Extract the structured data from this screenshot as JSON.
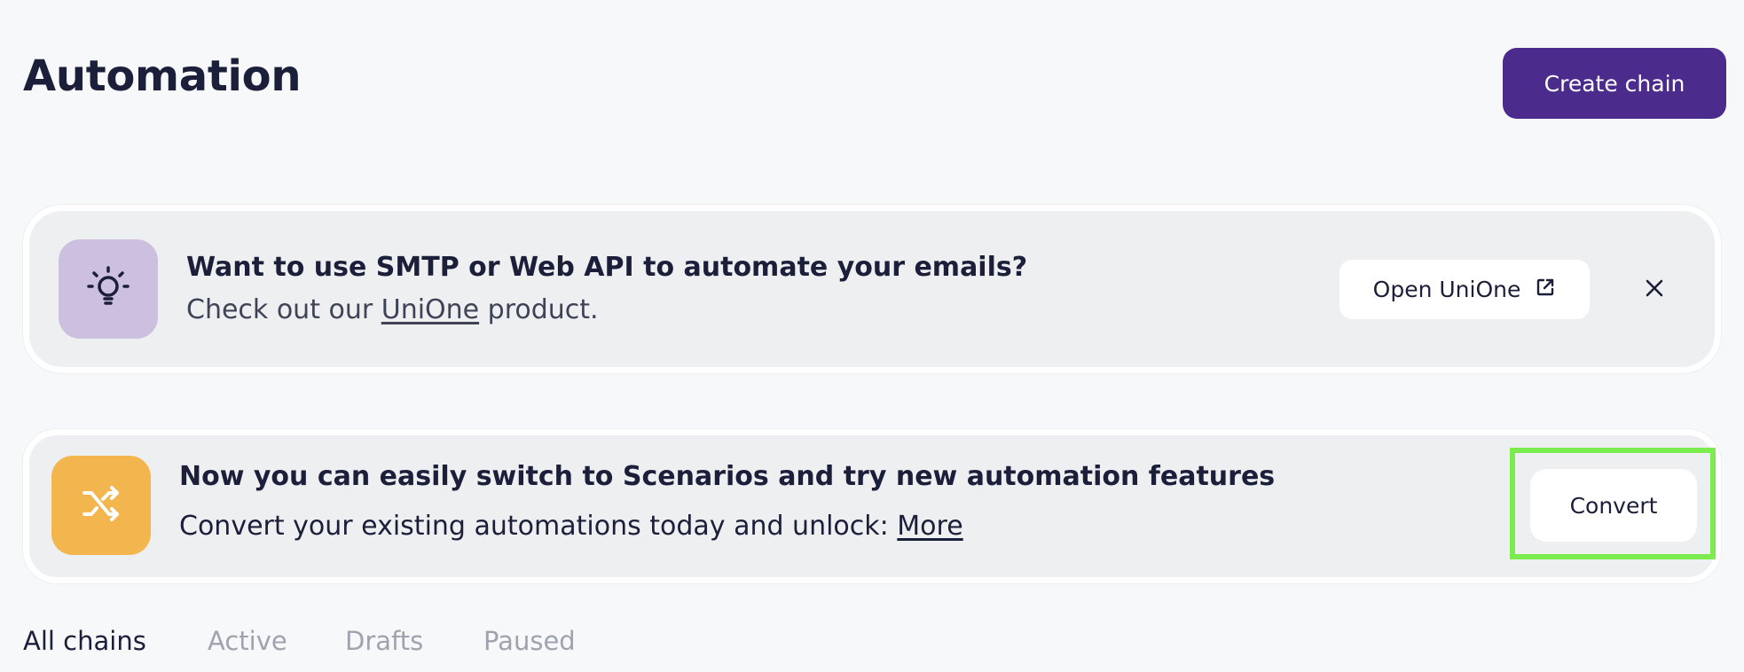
{
  "header": {
    "title": "Automation",
    "create_button_label": "Create chain"
  },
  "banners": {
    "unione": {
      "icon": "lightbulb-icon",
      "title": "Want to use SMTP or Web API to automate your emails?",
      "text_before": "Check out our ",
      "link_label": "UniOne",
      "text_after": " product.",
      "open_button_label": "Open UniOne",
      "open_button_icon": "external-link-icon",
      "close_icon": "close-icon"
    },
    "scenarios": {
      "icon": "shuffle-icon",
      "title": "Now you can easily switch to Scenarios and try new automation features",
      "text_before": "Convert your existing automations today and unlock: ",
      "link_label": "More",
      "convert_button_label": "Convert"
    }
  },
  "tabs": [
    {
      "label": "All chains",
      "active": true
    },
    {
      "label": "Active",
      "active": false
    },
    {
      "label": "Drafts",
      "active": false
    },
    {
      "label": "Paused",
      "active": false
    }
  ],
  "colors": {
    "primary": "#4b2b8c",
    "highlight": "#7ceb4d",
    "bulb_tile": "#cdbfdf",
    "shuffle_tile": "#f3b64f"
  }
}
